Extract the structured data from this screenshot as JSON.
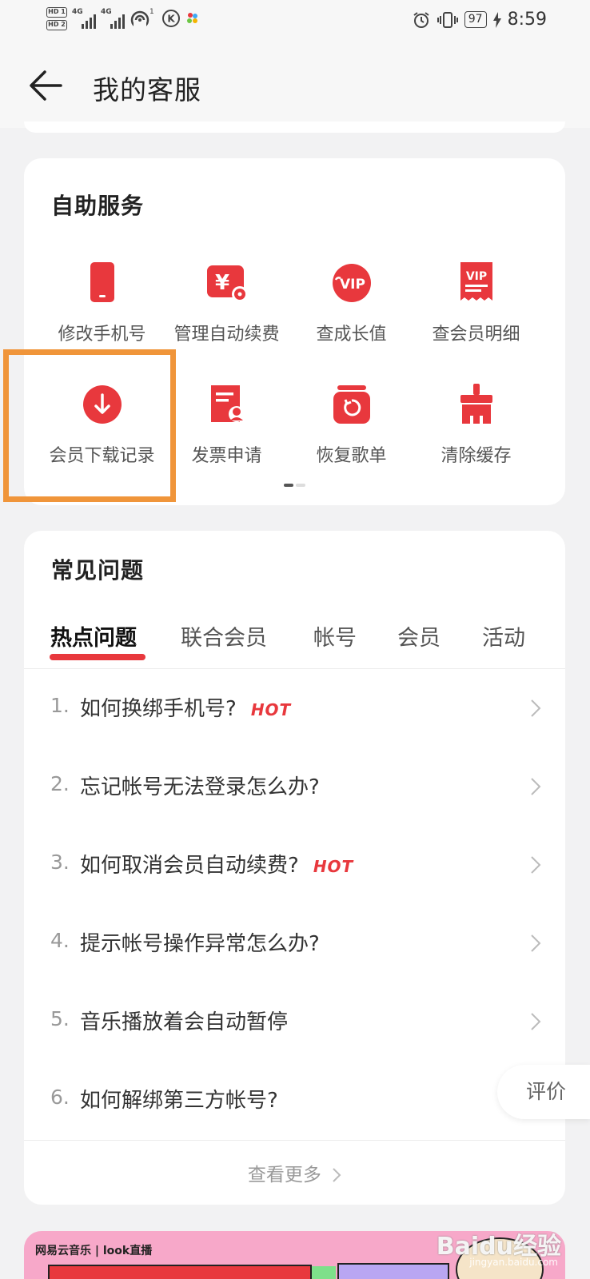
{
  "status_bar": {
    "hd1": "HD 1",
    "hd2": "HD 2",
    "signal1_label": "4G",
    "signal2_label": "4G",
    "hotspot_count": "1",
    "battery": "97",
    "time": "8:59"
  },
  "header": {
    "title": "我的客服"
  },
  "self_service": {
    "title": "自助服务",
    "items": [
      {
        "label": "修改手机号",
        "icon": "phone-icon"
      },
      {
        "label": "管理自动续费",
        "icon": "yuan-card-icon"
      },
      {
        "label": "查成长值",
        "icon": "vip-badge-icon"
      },
      {
        "label": "查会员明细",
        "icon": "vip-receipt-icon"
      },
      {
        "label": "会员下载记录",
        "icon": "download-icon"
      },
      {
        "label": "发票申请",
        "icon": "invoice-icon"
      },
      {
        "label": "恢复歌单",
        "icon": "restore-icon"
      },
      {
        "label": "清除缓存",
        "icon": "broom-icon"
      }
    ],
    "highlighted_item": "会员下载记录"
  },
  "faq": {
    "title": "常见问题",
    "tabs": [
      "热点问题",
      "联合会员",
      "帐号",
      "会员",
      "活动"
    ],
    "active_tab": "热点问题",
    "items": [
      {
        "num": "1.",
        "text": "如何换绑手机号?",
        "badge": "HOT"
      },
      {
        "num": "2.",
        "text": "忘记帐号无法登录怎么办?",
        "badge": ""
      },
      {
        "num": "3.",
        "text": "如何取消会员自动续费?",
        "badge": "HOT"
      },
      {
        "num": "4.",
        "text": "提示帐号操作异常怎么办?",
        "badge": ""
      },
      {
        "num": "5.",
        "text": "音乐播放着会自动暂停",
        "badge": ""
      },
      {
        "num": "6.",
        "text": "如何解绑第三方帐号?",
        "badge": ""
      }
    ],
    "more_label": "查看更多"
  },
  "rate_button": "评价",
  "banner": {
    "brand_text": "网易云音乐 | look直播"
  },
  "watermark": {
    "main": "Baidu经验",
    "sub": "jingyan.baidu.com"
  },
  "colors": {
    "accent_red": "#e8383d",
    "highlight_orange": "#f0953a",
    "background": "#f2f2f3"
  }
}
